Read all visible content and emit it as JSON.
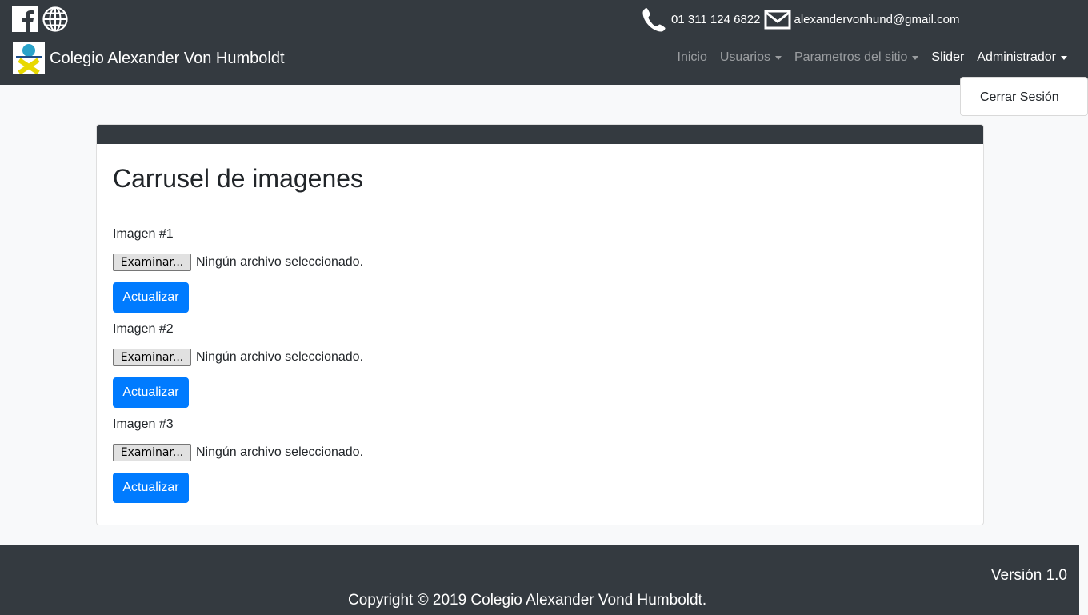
{
  "header": {
    "social": {
      "facebook_icon": "facebook-icon",
      "web_icon": "globe-icon"
    },
    "contact": {
      "phone": "01 311 124 6822",
      "email": "alexandervonhund@gmail.com"
    },
    "brand": {
      "name": "Colegio Alexander Von Humboldt"
    },
    "nav": {
      "items": [
        {
          "label": "Inicio"
        },
        {
          "label": "Usuarios"
        },
        {
          "label": "Parametros del sitio"
        },
        {
          "label": "Slider"
        },
        {
          "label": "Administrador"
        }
      ]
    },
    "dropdown": {
      "logout": "Cerrar Sesión"
    }
  },
  "main": {
    "title": "Carrusel de imagenes",
    "groups": [
      {
        "label": "Imagen #1",
        "browse": "Examinar...",
        "status": "Ningún archivo seleccionado.",
        "submit": "Actualizar"
      },
      {
        "label": "Imagen #2",
        "browse": "Examinar...",
        "status": "Ningún archivo seleccionado.",
        "submit": "Actualizar"
      },
      {
        "label": "Imagen #3",
        "browse": "Examinar...",
        "status": "Ningún archivo seleccionado.",
        "submit": "Actualizar"
      }
    ]
  },
  "footer": {
    "version": "Versión 1.0",
    "copyright": "Copyright © 2019 Colegio Alexander Vond Humboldt."
  },
  "colors": {
    "dark": "#343a40",
    "primary": "#007bff",
    "background": "#f8f9fa"
  }
}
